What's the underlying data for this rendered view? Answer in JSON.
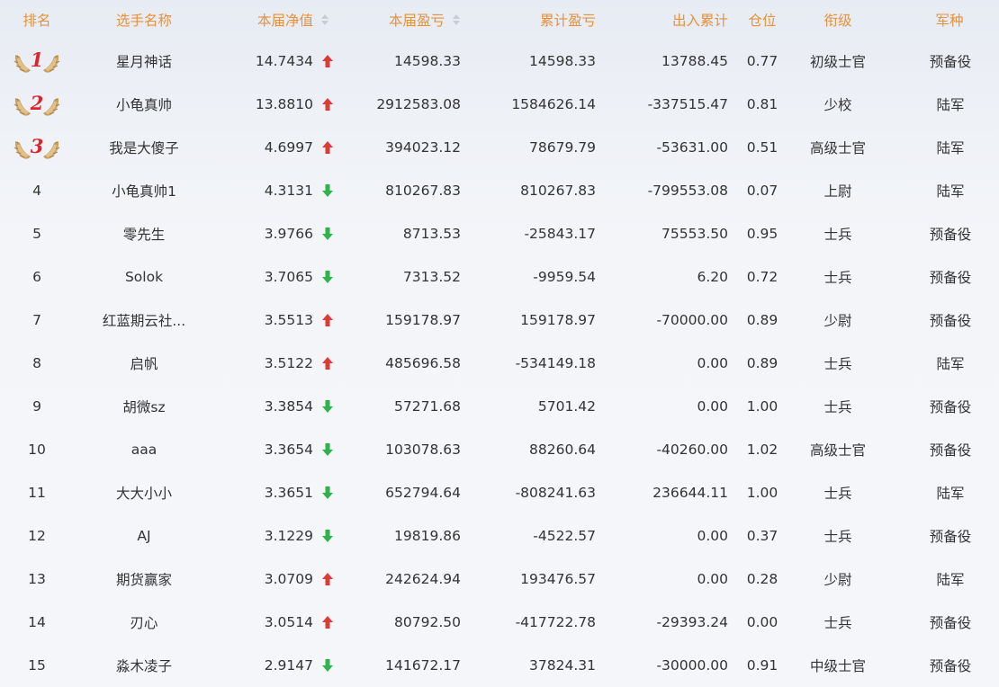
{
  "colors": {
    "header_text": "#e8913b",
    "up": "#dd3b36",
    "down": "#2fb34a",
    "medal_rank": "#d8262c"
  },
  "header": {
    "rank": "排名",
    "name": "选手名称",
    "nav": "本届净值",
    "pnl": "本届盈亏",
    "cum_pnl": "累计盈亏",
    "flow": "出入累计",
    "position": "仓位",
    "grade": "衔级",
    "arm": "军种"
  },
  "rows": [
    {
      "rank": "1",
      "name": "星月神话",
      "nav": "14.7434",
      "trend": "up",
      "pnl": "14598.33",
      "cum_pnl": "14598.33",
      "flow": "13788.45",
      "position": "0.77",
      "grade": "初级士官",
      "arm": "预备役"
    },
    {
      "rank": "2",
      "name": "小龟真帅",
      "nav": "13.8810",
      "trend": "up",
      "pnl": "2912583.08",
      "cum_pnl": "1584626.14",
      "flow": "-337515.47",
      "position": "0.81",
      "grade": "少校",
      "arm": "陆军"
    },
    {
      "rank": "3",
      "name": "我是大傻子",
      "nav": "4.6997",
      "trend": "up",
      "pnl": "394023.12",
      "cum_pnl": "78679.79",
      "flow": "-53631.00",
      "position": "0.51",
      "grade": "高级士官",
      "arm": "陆军"
    },
    {
      "rank": "4",
      "name": "小龟真帅1",
      "nav": "4.3131",
      "trend": "down",
      "pnl": "810267.83",
      "cum_pnl": "810267.83",
      "flow": "-799553.08",
      "position": "0.07",
      "grade": "上尉",
      "arm": "陆军"
    },
    {
      "rank": "5",
      "name": "零先生",
      "nav": "3.9766",
      "trend": "down",
      "pnl": "8713.53",
      "cum_pnl": "-25843.17",
      "flow": "75553.50",
      "position": "0.95",
      "grade": "士兵",
      "arm": "预备役"
    },
    {
      "rank": "6",
      "name": "Solok",
      "nav": "3.7065",
      "trend": "down",
      "pnl": "7313.52",
      "cum_pnl": "-9959.54",
      "flow": "6.20",
      "position": "0.72",
      "grade": "士兵",
      "arm": "预备役"
    },
    {
      "rank": "7",
      "name": "红蓝期云社...",
      "nav": "3.5513",
      "trend": "up",
      "pnl": "159178.97",
      "cum_pnl": "159178.97",
      "flow": "-70000.00",
      "position": "0.89",
      "grade": "少尉",
      "arm": "预备役"
    },
    {
      "rank": "8",
      "name": "启帆",
      "nav": "3.5122",
      "trend": "up",
      "pnl": "485696.58",
      "cum_pnl": "-534149.18",
      "flow": "0.00",
      "position": "0.89",
      "grade": "士兵",
      "arm": "陆军"
    },
    {
      "rank": "9",
      "name": "胡微sz",
      "nav": "3.3854",
      "trend": "down",
      "pnl": "57271.68",
      "cum_pnl": "5701.42",
      "flow": "0.00",
      "position": "1.00",
      "grade": "士兵",
      "arm": "预备役"
    },
    {
      "rank": "10",
      "name": "aaa",
      "nav": "3.3654",
      "trend": "down",
      "pnl": "103078.63",
      "cum_pnl": "88260.64",
      "flow": "-40260.00",
      "position": "1.02",
      "grade": "高级士官",
      "arm": "预备役"
    },
    {
      "rank": "11",
      "name": "大大小小",
      "nav": "3.3651",
      "trend": "down",
      "pnl": "652794.64",
      "cum_pnl": "-808241.63",
      "flow": "236644.11",
      "position": "1.00",
      "grade": "士兵",
      "arm": "陆军"
    },
    {
      "rank": "12",
      "name": "AJ",
      "nav": "3.1229",
      "trend": "down",
      "pnl": "19819.86",
      "cum_pnl": "-4522.57",
      "flow": "0.00",
      "position": "0.37",
      "grade": "士兵",
      "arm": "预备役"
    },
    {
      "rank": "13",
      "name": "期货赢家",
      "nav": "3.0709",
      "trend": "up",
      "pnl": "242624.94",
      "cum_pnl": "193476.57",
      "flow": "0.00",
      "position": "0.28",
      "grade": "少尉",
      "arm": "陆军"
    },
    {
      "rank": "14",
      "name": "刃心",
      "nav": "3.0514",
      "trend": "up",
      "pnl": "80792.50",
      "cum_pnl": "-417722.78",
      "flow": "-29393.24",
      "position": "0.00",
      "grade": "士兵",
      "arm": "预备役"
    },
    {
      "rank": "15",
      "name": "淼木凌子",
      "nav": "2.9147",
      "trend": "down",
      "pnl": "141672.17",
      "cum_pnl": "37824.31",
      "flow": "-30000.00",
      "position": "0.91",
      "grade": "中级士官",
      "arm": "预备役"
    }
  ]
}
